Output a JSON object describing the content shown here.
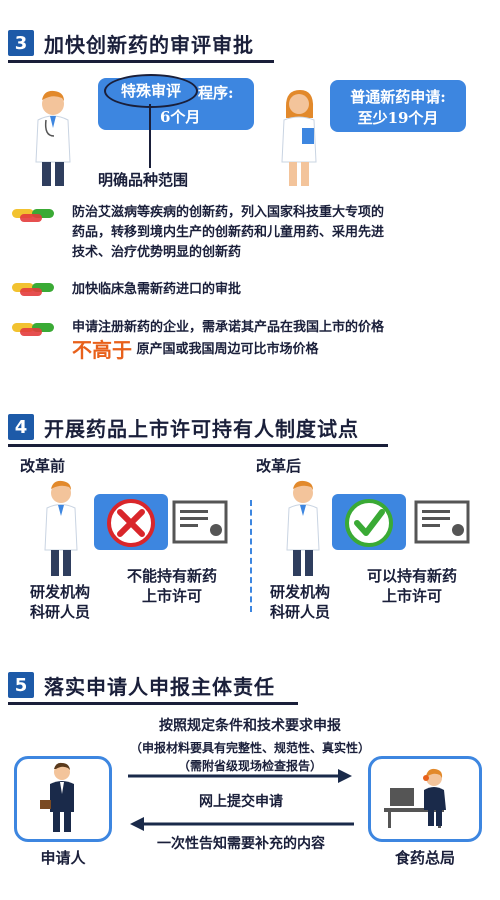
{
  "section3": {
    "number": "3",
    "title": "加快创新药的审评审批",
    "special_tag": "特殊审评",
    "special_suffix": "程序:",
    "special_time": "6个月",
    "normal_title": "普通新药申请:",
    "normal_time": "至少19个月",
    "range_label": "明确品种范围",
    "bullets": [
      {
        "lines": [
          "防治艾滋病等疾病的创新药，列入国家科技重大专项的",
          "药品，转移到境内生产的创新药和儿童用药、采用先进",
          "技术、治疗优势明显的创新药"
        ]
      },
      {
        "lines": [
          "加快临床急需新药进口的审批"
        ]
      },
      {
        "lines": [
          "申请注册新药的企业，需承诺其产品在我国上市的价格"
        ],
        "emphasis": "不高于",
        "tail": "原产国或我国周边可比市场价格"
      }
    ]
  },
  "section4": {
    "number": "4",
    "title": "开展药品上市许可持有人制度试点",
    "before_label": "改革前",
    "after_label": "改革后",
    "before_result": [
      "不能持有新药",
      "上市许可"
    ],
    "after_result": [
      "可以持有新药",
      "上市许可"
    ],
    "person_label": [
      "研发机构",
      "科研人员"
    ]
  },
  "section5": {
    "number": "5",
    "title": "落实申请人申报主体责任",
    "line1": "按照规定条件和技术要求申报",
    "line2": "（申报材料要具有完整性、规范性、真实性）",
    "line3": "（需附省级现场检查报告）",
    "online": "网上提交申请",
    "notify": "一次性告知需要补充的内容",
    "applicant": "申请人",
    "agency": "食药总局"
  },
  "colors": {
    "accent": "#3d86e0",
    "dark": "#1a1f3a",
    "section_num": "#1d5aa8",
    "emphasis": "#e8601a",
    "red": "#d9262b",
    "green": "#3aaa35"
  }
}
